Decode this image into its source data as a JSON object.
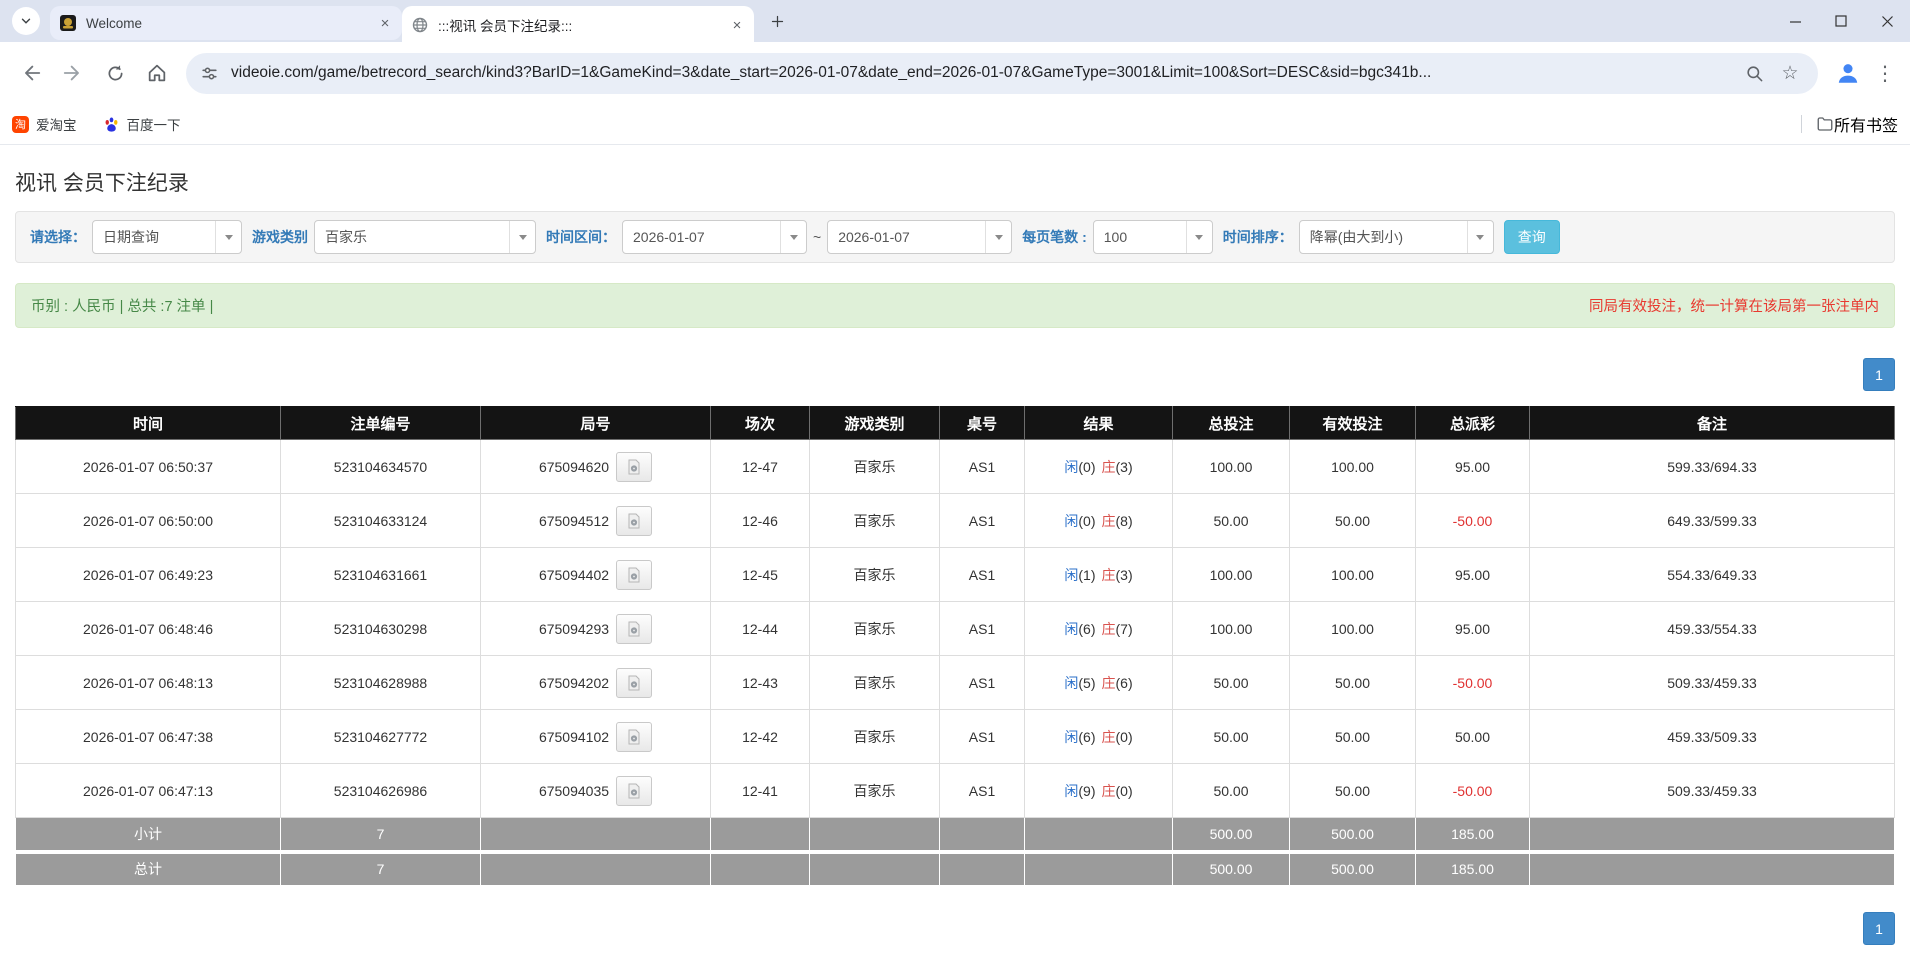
{
  "browser": {
    "tab_strip": {
      "tabs": [
        {
          "title": "Welcome"
        },
        {
          "title": ":::视讯 会员下注纪录:::"
        }
      ]
    },
    "toolbar": {
      "url": "videoie.com/game/betrecord_search/kind3?BarID=1&GameKind=3&date_start=2026-01-07&date_end=2026-01-07&GameType=3001&Limit=100&Sort=DESC&sid=bgc341b..."
    },
    "bookmarks_bar": {
      "items": [
        {
          "label": "爱淘宝",
          "icon_glyph": "淘"
        },
        {
          "label": "百度一下"
        }
      ],
      "all_bookmarks": "所有书签"
    }
  },
  "page": {
    "title": "视讯 会员下注纪录",
    "filters": {
      "select_label": "请选择：",
      "select_value": "日期查询",
      "game_kind_label": "游戏类别",
      "game_kind_value": "百家乐",
      "date_range_label": "时间区间：",
      "date_start": "2026-01-07",
      "range_separator": "~",
      "date_end": "2026-01-07",
      "per_page_label": "每页笔数 :",
      "per_page_value": "100",
      "sort_label": "时间排序：",
      "sort_value": "降幂(由大到小)",
      "search_button": "查询"
    },
    "summary_bar": {
      "left": "币别 : 人民币 | 总共 :7 注单 |",
      "right": "同局有效投注，统一计算在该局第一张注单内"
    },
    "pagination": {
      "page": "1"
    },
    "colors": {
      "pagination_blue": "#428bca",
      "search_button_blue": "#5bc0de",
      "summary_bg_green": "#dff0d8",
      "summary_text_green": "#468847",
      "alert_red": "#e8392f",
      "player_blue": "#2a6fc9",
      "banker_red": "#d9534f",
      "bet_link_blue": "#337ab7",
      "negative_red": "#e03131"
    },
    "table": {
      "headers": [
        "时间",
        "注单编号",
        "局号",
        "场次",
        "游戏类别",
        "桌号",
        "结果",
        "总投注",
        "有效投注",
        "总派彩",
        "备注"
      ],
      "rows": [
        {
          "time": "2026-01-07 06:50:37",
          "bet_id": "523104634570",
          "round": "675094620",
          "session": "12-47",
          "game": "百家乐",
          "table_no": "AS1",
          "player": "闲",
          "player_n": "(0)",
          "banker": "庄",
          "banker_n": "(3)",
          "total_bet": "100.00",
          "valid_bet": "100.00",
          "payout": "95.00",
          "note": "599.33/694.33"
        },
        {
          "time": "2026-01-07 06:50:00",
          "bet_id": "523104633124",
          "round": "675094512",
          "session": "12-46",
          "game": "百家乐",
          "table_no": "AS1",
          "player": "闲",
          "player_n": "(0)",
          "banker": "庄",
          "banker_n": "(8)",
          "total_bet": "50.00",
          "valid_bet": "50.00",
          "payout": "-50.00",
          "note": "649.33/599.33"
        },
        {
          "time": "2026-01-07 06:49:23",
          "bet_id": "523104631661",
          "round": "675094402",
          "session": "12-45",
          "game": "百家乐",
          "table_no": "AS1",
          "player": "闲",
          "player_n": "(1)",
          "banker": "庄",
          "banker_n": "(3)",
          "total_bet": "100.00",
          "valid_bet": "100.00",
          "payout": "95.00",
          "note": "554.33/649.33"
        },
        {
          "time": "2026-01-07 06:48:46",
          "bet_id": "523104630298",
          "round": "675094293",
          "session": "12-44",
          "game": "百家乐",
          "table_no": "AS1",
          "player": "闲",
          "player_n": "(6)",
          "banker": "庄",
          "banker_n": "(7)",
          "total_bet": "100.00",
          "valid_bet": "100.00",
          "payout": "95.00",
          "note": "459.33/554.33"
        },
        {
          "time": "2026-01-07 06:48:13",
          "bet_id": "523104628988",
          "round": "675094202",
          "session": "12-43",
          "game": "百家乐",
          "table_no": "AS1",
          "player": "闲",
          "player_n": "(5)",
          "banker": "庄",
          "banker_n": "(6)",
          "total_bet": "50.00",
          "valid_bet": "50.00",
          "payout": "-50.00",
          "note": "509.33/459.33"
        },
        {
          "time": "2026-01-07 06:47:38",
          "bet_id": "523104627772",
          "round": "675094102",
          "session": "12-42",
          "game": "百家乐",
          "table_no": "AS1",
          "player": "闲",
          "player_n": "(6)",
          "banker": "庄",
          "banker_n": "(0)",
          "total_bet": "50.00",
          "valid_bet": "50.00",
          "payout": "50.00",
          "note": "459.33/509.33"
        },
        {
          "time": "2026-01-07 06:47:13",
          "bet_id": "523104626986",
          "round": "675094035",
          "session": "12-41",
          "game": "百家乐",
          "table_no": "AS1",
          "player": "闲",
          "player_n": "(9)",
          "banker": "庄",
          "banker_n": "(0)",
          "total_bet": "50.00",
          "valid_bet": "50.00",
          "payout": "-50.00",
          "note": "509.33/459.33"
        }
      ],
      "subtotal": {
        "label": "小计",
        "count": "7",
        "total_bet": "500.00",
        "valid_bet": "500.00",
        "payout": "185.00"
      },
      "total": {
        "label": "总计",
        "count": "7",
        "total_bet": "500.00",
        "valid_bet": "500.00",
        "payout": "185.00"
      }
    }
  }
}
